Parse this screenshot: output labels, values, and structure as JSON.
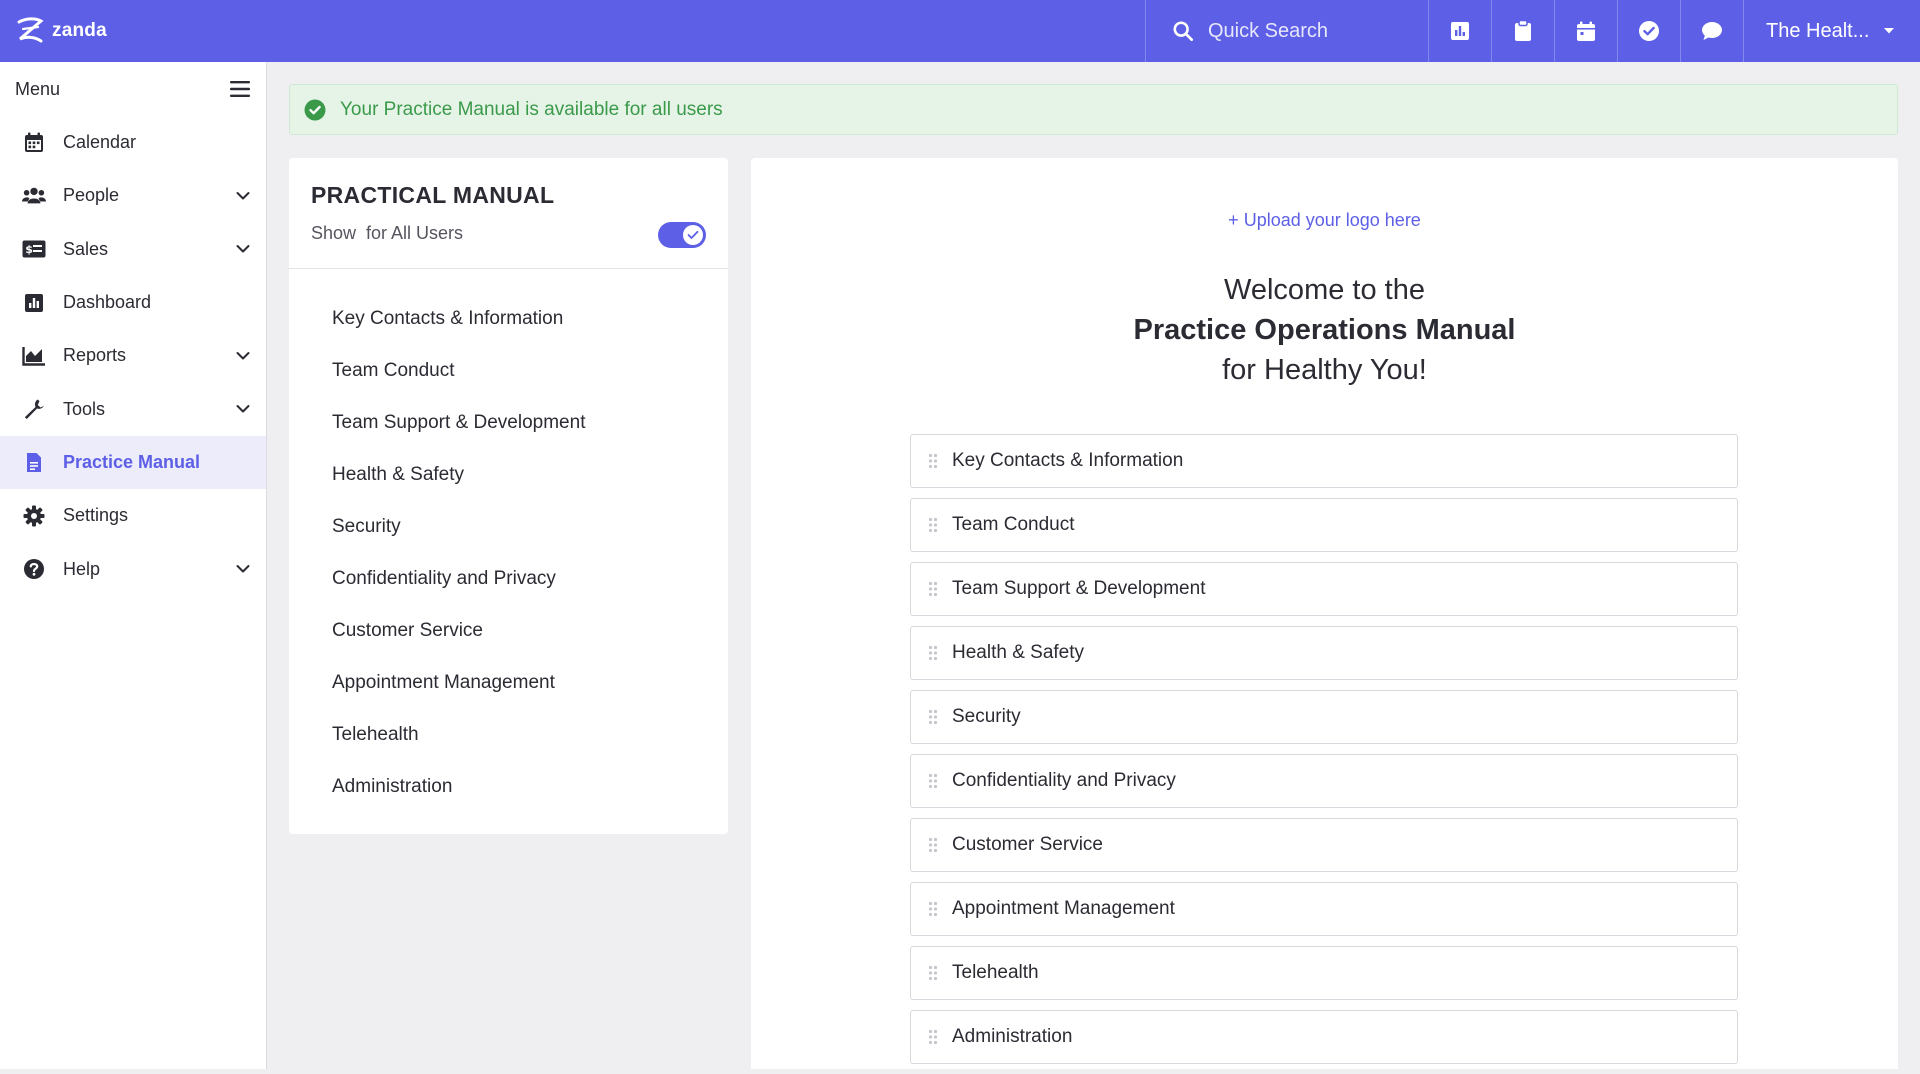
{
  "brand": {
    "name": "zanda"
  },
  "topbar": {
    "search_label": "Quick Search",
    "account_label": "The Healt..."
  },
  "sidebar": {
    "menu_label": "Menu",
    "items": [
      {
        "label": "Calendar",
        "icon": "calendar-icon",
        "has_children": false
      },
      {
        "label": "People",
        "icon": "people-icon",
        "has_children": true
      },
      {
        "label": "Sales",
        "icon": "sales-icon",
        "has_children": true
      },
      {
        "label": "Dashboard",
        "icon": "dashboard-icon",
        "has_children": false
      },
      {
        "label": "Reports",
        "icon": "reports-icon",
        "has_children": true
      },
      {
        "label": "Tools",
        "icon": "wrench-icon",
        "has_children": true
      },
      {
        "label": "Practice Manual",
        "icon": "document-icon",
        "has_children": false,
        "active": true
      },
      {
        "label": "Settings",
        "icon": "gear-icon",
        "has_children": false
      },
      {
        "label": "Help",
        "icon": "help-icon",
        "has_children": true
      }
    ]
  },
  "banner": {
    "text": "Your Practice Manual is available for all users"
  },
  "manual_panel": {
    "title": "PRACTICAL MANUAL",
    "show_label": "Show  for All Users",
    "toggle_on": true,
    "toc": [
      "Key Contacts & Information",
      "Team Conduct",
      "Team Support & Development",
      "Health & Safety",
      "Security",
      "Confidentiality and Privacy",
      "Customer Service",
      "Appointment Management",
      "Telehealth",
      "Administration"
    ]
  },
  "content": {
    "upload_label": "Upload your logo here",
    "welcome_line1": "Welcome to the",
    "welcome_line2": "Practice Operations Manual",
    "welcome_line3": "for Healthy You!",
    "sections": [
      "Key Contacts & Information",
      "Team Conduct",
      "Team Support & Development",
      "Health & Safety",
      "Security",
      "Confidentiality and Privacy",
      "Customer Service",
      "Appointment Management",
      "Telehealth",
      "Administration"
    ]
  },
  "colors": {
    "accent": "#5d5fe6",
    "success": "#3b9a4a",
    "success_bg": "#e6f4e8"
  }
}
